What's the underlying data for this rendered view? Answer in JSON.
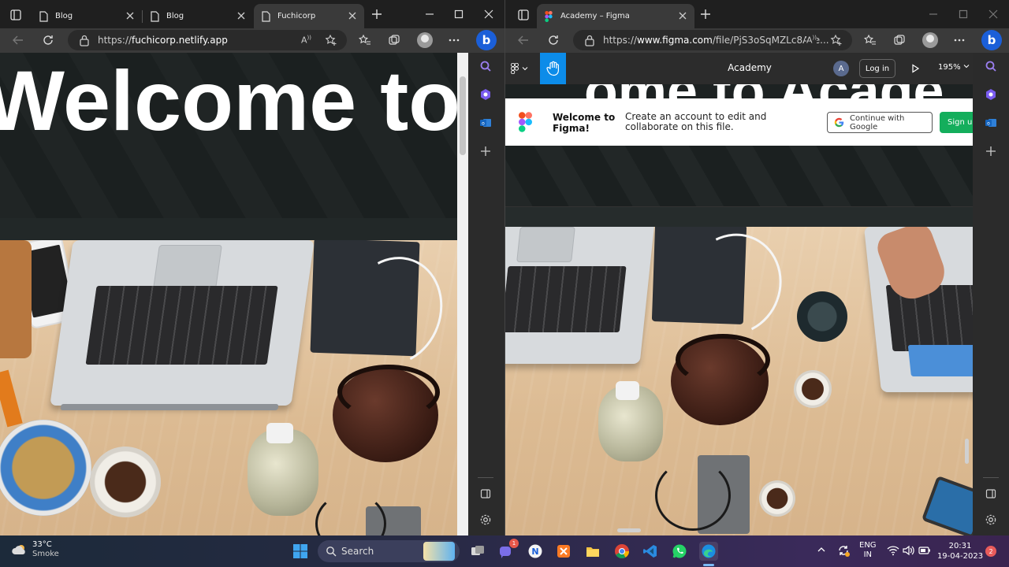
{
  "left_window": {
    "tabs": [
      {
        "label": "Blog"
      },
      {
        "label": "Blog"
      },
      {
        "label": "Fuchicorp"
      }
    ],
    "address": {
      "scheme": "https://",
      "host": "fuchicorp.netlify.app"
    },
    "hero_title": "Welcome to A"
  },
  "right_window": {
    "tabs": [
      {
        "label": "Academy – Figma"
      }
    ],
    "address": {
      "scheme": "https://",
      "host": "www.figma.com",
      "path": "/file/PjS3oSqMZLc8ALe..."
    },
    "figma": {
      "file_title": "Academy",
      "avatar_letter": "A",
      "login_label": "Log in",
      "zoom_label": "195%",
      "banner_title": "Welcome to Figma!",
      "banner_text": "Create an account to edit and collaborate on this file.",
      "google_button": "Continue with Google",
      "signup_button": "Sign up"
    }
  },
  "taskbar": {
    "weather": {
      "temp": "33°C",
      "condition": "Smoke"
    },
    "search_label": "Search",
    "teams_badge": "1",
    "language": {
      "line1": "ENG",
      "line2": "IN"
    },
    "clock": {
      "time": "20:31",
      "date": "19-04-2023"
    },
    "notifications": "2"
  },
  "colors": {
    "figma_blue": "#0c8ce9",
    "figma_green": "#14ae5c",
    "edge_blue": "#1b5fd8",
    "tab_bar": "#1f1f1f",
    "toolbar": "#3a3a3a"
  }
}
